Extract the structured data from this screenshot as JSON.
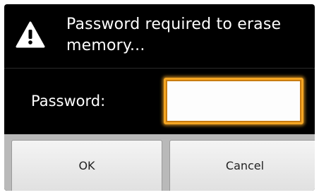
{
  "dialog": {
    "title": "Password required to erase memory...",
    "icon": "warning-icon",
    "password_label": "Password:",
    "password_value": "",
    "ok_label": "OK",
    "cancel_label": "Cancel"
  },
  "colors": {
    "dialog_background": "#000000",
    "input_focus_border": "#f5a623",
    "button_background": "#e8e8e8"
  }
}
